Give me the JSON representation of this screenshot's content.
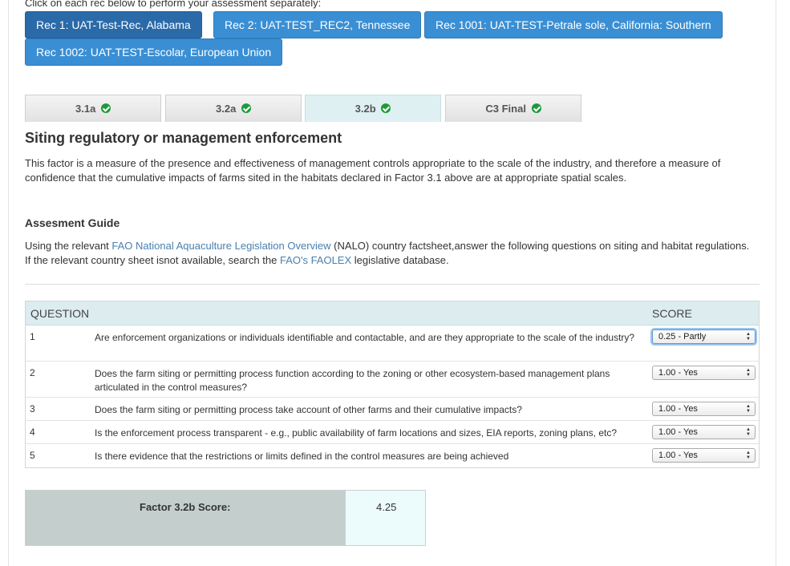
{
  "intro": "Click on each rec below to perform your assessment separately:",
  "recs": [
    {
      "label": "Rec 1: UAT-Test-Rec, Alabama",
      "active": true
    },
    {
      "label": "Rec 2: UAT-TEST_REC2, Tennessee",
      "active": false
    },
    {
      "label": "Rec 1001: UAT-TEST-Petrale sole, California: Southern",
      "active": false
    },
    {
      "label": "Rec 1002: UAT-TEST-Escolar, European Union",
      "active": false
    }
  ],
  "tabs": [
    {
      "label": "3.1a",
      "icon": "check-circle-icon"
    },
    {
      "label": "3.2a",
      "icon": "check-circle-icon"
    },
    {
      "label": "3.2b",
      "icon": "check-circle-icon",
      "active": true
    },
    {
      "label": "C3 Final",
      "icon": "check-circle-icon"
    }
  ],
  "section": {
    "title": "Siting regulatory or management enforcement",
    "description": "This factor is a measure of the presence and effectiveness of management controls appropriate to the scale of the industry, and therefore a measure of confidence that the cumulative impacts of farms sited in the habitats declared in Factor 3.1 above are at appropriate spatial scales."
  },
  "guide": {
    "heading": "Assesment Guide",
    "text_1": "Using the relevant ",
    "link_1": "FAO National Aquaculture Legislation Overview",
    "text_2": " (NALO) country factsheet,answer the following questions on siting and habitat regulations. If the relevant country sheet isnot available, search the ",
    "link_2": "FAO's FAOLEX",
    "text_3": " legislative database."
  },
  "table": {
    "col_question": "QUESTION",
    "col_score": "SCORE",
    "rows": [
      {
        "num": "1",
        "question": "Are enforcement organizations or individuals identifiable and contactable, and are they appropriate to the scale of the industry?",
        "score": "0.25 - Partly"
      },
      {
        "num": "2",
        "question": "Does the farm siting or permitting process function according to the zoning or other ecosystem-based management plans articulated in the control measures?",
        "score": "1.00 - Yes"
      },
      {
        "num": "3",
        "question": "Does the farm siting or permitting process take account of other farms and their cumulative impacts?",
        "score": "1.00 - Yes"
      },
      {
        "num": "4",
        "question": "Is the enforcement process transparent - e.g., public availability of farm locations and sizes, EIA reports, zoning plans, etc?",
        "score": "1.00 - Yes"
      },
      {
        "num": "5",
        "question": "Is there evidence that the restrictions or limits defined in the control measures are being achieved",
        "score": "1.00 - Yes"
      }
    ]
  },
  "factor": {
    "label": "Factor 3.2b Score:",
    "value": "4.25"
  },
  "colors": {
    "button": "#3a8fd4",
    "button_active": "#2a6aa8",
    "tab_active": "#dff0f2",
    "check": "#1e9a3a",
    "table_header": "#dcecef",
    "score_label_bg": "#c4cfcd",
    "score_value_bg": "#ecfcfd"
  }
}
